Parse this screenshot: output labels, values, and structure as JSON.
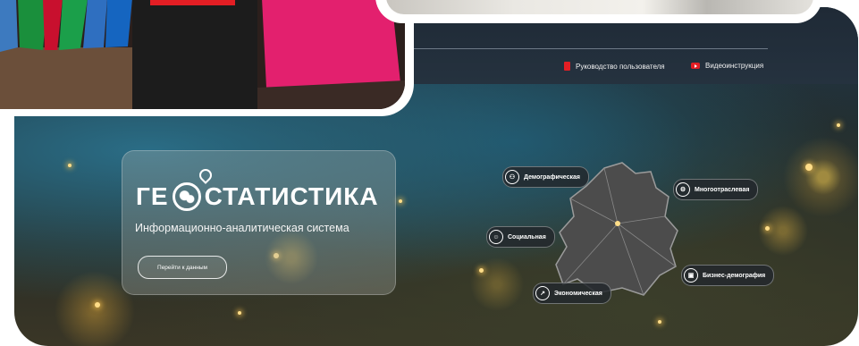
{
  "header": {
    "links": [
      {
        "label": "Руководство пользователя",
        "icon": "pdf-icon"
      },
      {
        "label": "Видеоинструкция",
        "icon": "youtube-icon"
      }
    ]
  },
  "hero": {
    "logo_left": "ГЕ",
    "logo_right": "СТАТИСТИКА",
    "subtitle": "Информационно-аналитическая система",
    "button_label": "Перейти к данным"
  },
  "categories": [
    {
      "label": "Демографическая",
      "icon": "people-icon"
    },
    {
      "label": "Многоотраслевая",
      "icon": "industry-icon"
    },
    {
      "label": "Социальная",
      "icon": "social-icon"
    },
    {
      "label": "Бизнес-демография",
      "icon": "business-icon"
    },
    {
      "label": "Экономическая",
      "icon": "economy-icon"
    }
  ],
  "colors": {
    "accent": "#e31e24",
    "map_fill": "#4a4a4a"
  }
}
